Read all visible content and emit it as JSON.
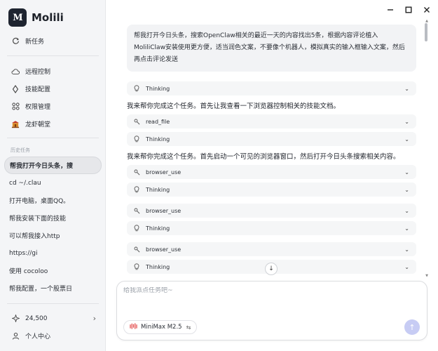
{
  "app": {
    "name": "Molili",
    "logo_text": "M"
  },
  "sidebar": {
    "new_task": "新任务",
    "nav": [
      {
        "label": "远程控制",
        "icon": "cloud-icon"
      },
      {
        "label": "技能配置",
        "icon": "skill-icon"
      },
      {
        "label": "权限管理",
        "icon": "permission-icon"
      },
      {
        "label": "龙虾朝堂",
        "icon": "lobster-icon"
      }
    ],
    "history_label": "历史任务",
    "history": [
      "帮我打开今日头条，搜",
      "cd ~/.clau",
      "打开电脑，桌面QQ。",
      "帮我安装下面的技能",
      "可以帮我接入http",
      "https://gi",
      "使用 cocoloo",
      "帮我配置，一个股票日"
    ],
    "credits": "24,500",
    "profile": "个人中心"
  },
  "chat": {
    "user_message": "帮我打开今日头条，搜索OpenClaw相关的最近一天的内容找出5条，根据内容评论植入MoliliClaw安装使用更方便，适当润色文案，不要像个机器人，模拟真实的输入框输入文案，然后再点击评论发送",
    "assistant_text_1": "我来帮你完成这个任务。首先让我查看一下浏览器控制相关的技能文档。",
    "assistant_text_2": "我来帮你完成这个任务。首先启动一个可见的浏览器窗口，然后打开今日头条搜索相关内容。",
    "thinking_label": "Thinking",
    "read_file_label": "read_file",
    "browser_use_label": "browser_use"
  },
  "composer": {
    "placeholder": "给我派点任务吧~",
    "model": "MiniMax M2.5"
  },
  "colors": {
    "accent": "#c7ccf4",
    "sidebar_bg": "#f4f5f7",
    "minimax_red": "#e03a3a"
  }
}
